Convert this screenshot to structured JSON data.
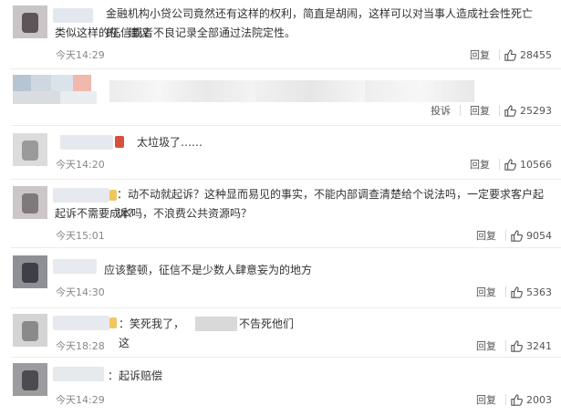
{
  "comments": [
    {
      "text_line1": "金融机构小贷公司竟然还有这样的权利，简直是胡闹，这样可以对当事人造成社会性死亡的，建议",
      "text_line2": "类似这样的征信或者不良记录全部通过法院定性。",
      "time": "今天14:29",
      "reply": "回复",
      "likes": "28455"
    },
    {
      "time": "",
      "report": "投诉",
      "reply": "回复",
      "likes": "25293"
    },
    {
      "text": "太垃圾了……",
      "time": "今天14:20",
      "reply": "回复",
      "likes": "10566"
    },
    {
      "text_line1": "：动不动就起诉？这种显而易见的事实，不能内部调查清楚给个说法吗，一定要求客户起诉？",
      "text_line2": "起诉不需要成本吗，不浪费公共资源吗？",
      "time": "今天15:01",
      "reply": "回复",
      "likes": "9054"
    },
    {
      "text": "应该整顿，征信不是少数人肆意妄为的地方",
      "time": "今天14:30",
      "reply": "回复",
      "likes": "5363"
    },
    {
      "text_a": "：笑死我了，这",
      "text_b": "不告死他们",
      "time": "今天18:28",
      "reply": "回复",
      "likes": "3241"
    },
    {
      "text": "：起诉赔偿",
      "time": "今天14:29",
      "reply": "回复",
      "likes": "2003"
    }
  ],
  "icons": {
    "like": "thumbs-up-icon"
  },
  "colors": {
    "text": "#333333",
    "muted": "#888888",
    "separator": "#ececec"
  }
}
